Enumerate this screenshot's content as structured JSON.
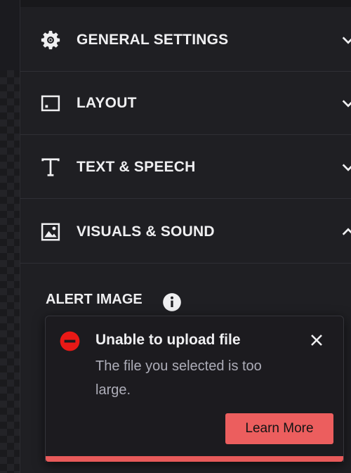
{
  "sections": [
    {
      "label": "GENERAL SETTINGS",
      "icon": "gear-icon",
      "expanded": false
    },
    {
      "label": "LAYOUT",
      "icon": "layout-icon",
      "expanded": false
    },
    {
      "label": "TEXT & SPEECH",
      "icon": "text-icon",
      "expanded": false
    },
    {
      "label": "VISUALS & SOUND",
      "icon": "image-icon",
      "expanded": true
    }
  ],
  "visuals": {
    "alert_image_label": "ALERT IMAGE",
    "info_icon": "info-icon"
  },
  "toast": {
    "title": "Unable to upload file",
    "message": "The file you selected is too large.",
    "button_label": "Learn More",
    "status_icon": "error-icon",
    "close_icon": "close-icon",
    "accent_color": "#e85a5a"
  },
  "colors": {
    "panel_bg": "#1f1f23",
    "text": "#efeff1",
    "muted_text": "#adadb8",
    "error": "#e91916"
  }
}
